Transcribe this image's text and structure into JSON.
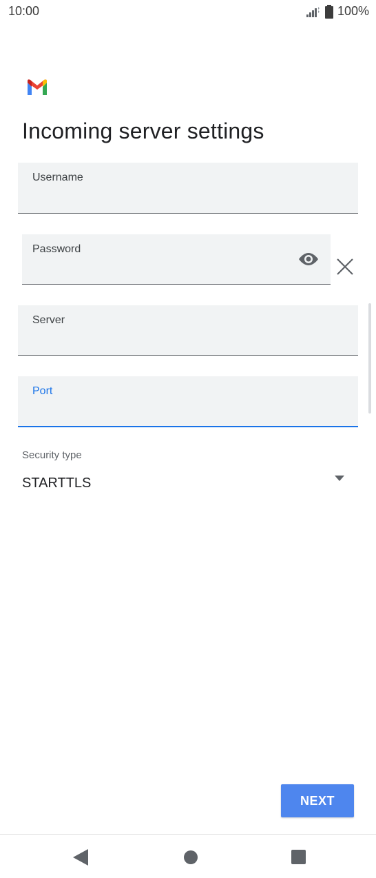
{
  "status_bar": {
    "time": "10:00",
    "battery": "100%"
  },
  "header": {
    "title": "Incoming server settings"
  },
  "fields": {
    "username": {
      "label": "Username",
      "value": ""
    },
    "password": {
      "label": "Password",
      "value": ""
    },
    "server": {
      "label": "Server",
      "value": ""
    },
    "port": {
      "label": "Port",
      "value": ""
    }
  },
  "security": {
    "label": "Security type",
    "value": "STARTTLS"
  },
  "actions": {
    "next_label": "NEXT"
  },
  "colors": {
    "accent": "#1a73e8",
    "button": "#4e86ee",
    "field_bg": "#f1f3f4"
  },
  "icons": [
    "signal-icon",
    "battery-icon",
    "gmail-logo",
    "eye-icon",
    "clear-icon",
    "dropdown-arrow-icon",
    "nav-back-icon",
    "nav-home-icon",
    "nav-recents-icon"
  ]
}
